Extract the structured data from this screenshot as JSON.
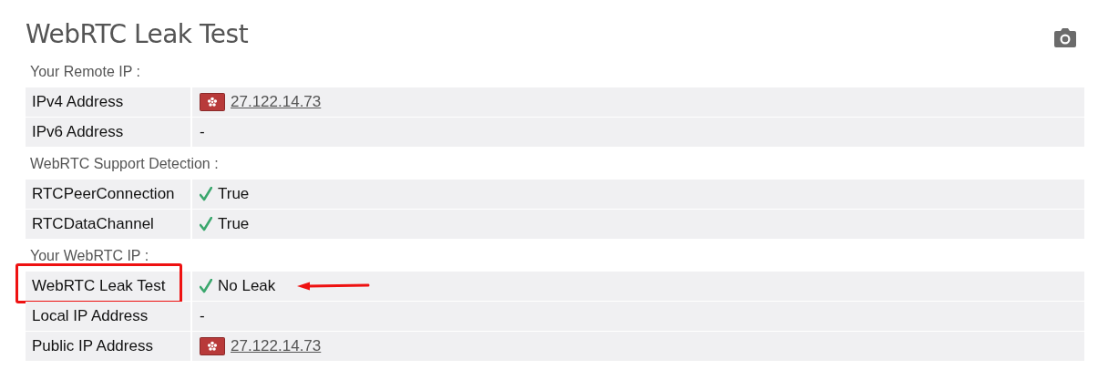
{
  "title": "WebRTC Leak Test",
  "sections": [
    {
      "title": "Your Remote IP :",
      "rows": [
        {
          "label": "IPv4 Address",
          "value": "27.122.14.73",
          "kind": "ip",
          "highlighted": false,
          "arrow": false
        },
        {
          "label": "IPv6 Address",
          "value": "-",
          "kind": "plain",
          "highlighted": false,
          "arrow": false
        }
      ]
    },
    {
      "title": "WebRTC Support Detection :",
      "rows": [
        {
          "label": "RTCPeerConnection",
          "value": "True",
          "kind": "check",
          "highlighted": false,
          "arrow": false
        },
        {
          "label": "RTCDataChannel",
          "value": "True",
          "kind": "check",
          "highlighted": false,
          "arrow": false
        }
      ]
    },
    {
      "title": "Your WebRTC IP :",
      "rows": [
        {
          "label": "WebRTC Leak Test",
          "value": "No Leak",
          "kind": "check",
          "highlighted": true,
          "arrow": true
        },
        {
          "label": "Local IP Address",
          "value": "-",
          "kind": "plain",
          "highlighted": false,
          "arrow": false
        },
        {
          "label": "Public IP Address",
          "value": "27.122.14.73",
          "kind": "ip",
          "highlighted": false,
          "arrow": false
        }
      ]
    }
  ]
}
